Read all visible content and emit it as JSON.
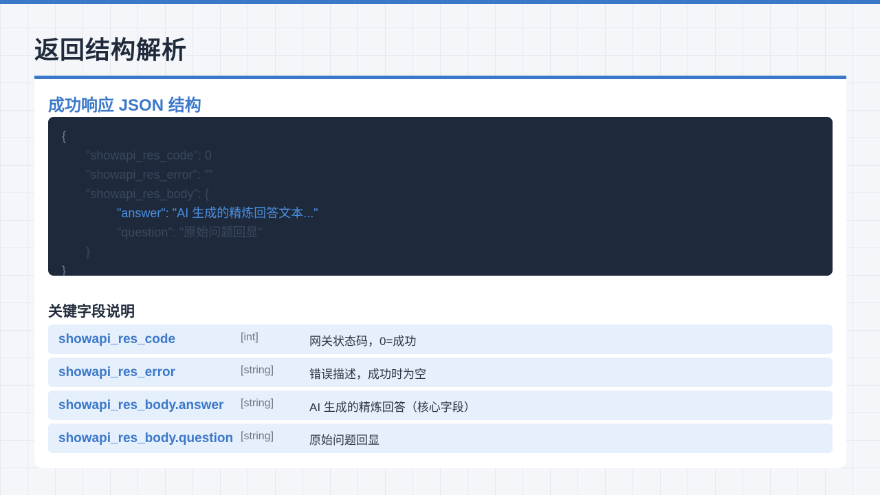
{
  "page": {
    "title": "返回结构解析"
  },
  "section": {
    "title": "成功响应 JSON 结构"
  },
  "code": {
    "lines": [
      "{",
      "\"showapi_res_code\": 0",
      "\"showapi_res_error\": \"\"",
      "\"showapi_res_body\": {",
      "\"answer\": \"AI 生成的精炼回答文本...\"",
      "\"question\": \"原始问题回显\"",
      "}",
      "}"
    ]
  },
  "fields": {
    "title": "关键字段说明",
    "rows": [
      {
        "name": "showapi_res_code",
        "type": "[int]",
        "desc": "网关状态码，0=成功"
      },
      {
        "name": "showapi_res_error",
        "type": "[string]",
        "desc": "错误描述，成功时为空"
      },
      {
        "name": "showapi_res_body.answer",
        "type": "[string]",
        "desc": "AI 生成的精炼回答（核心字段）"
      },
      {
        "name": "showapi_res_body.question",
        "type": "[string]",
        "desc": "原始问题回显"
      }
    ]
  },
  "colors": {
    "accent": "#3b78c9",
    "code_bg": "#1e293b",
    "row_bg": "#e6effc",
    "highlight": "#4a8fe0"
  }
}
